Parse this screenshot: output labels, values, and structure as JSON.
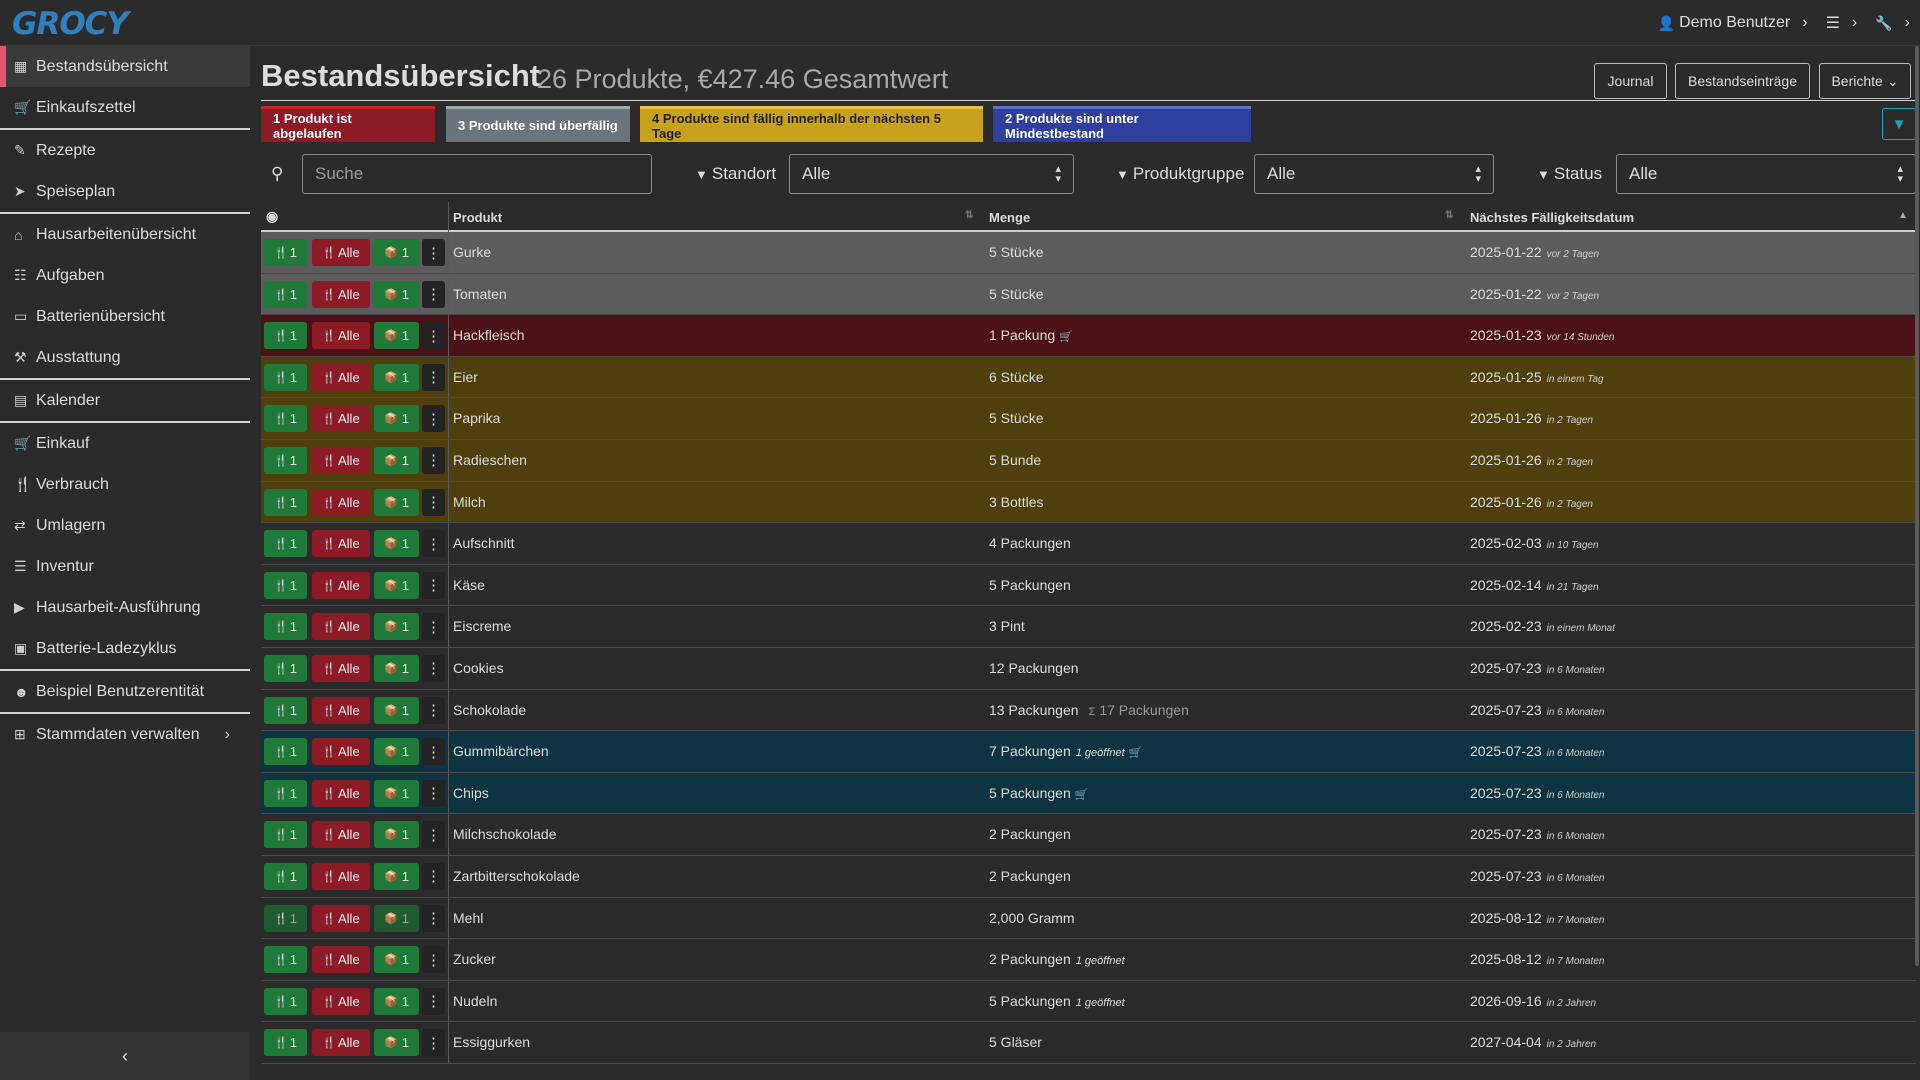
{
  "app": {
    "logo": "GROCY",
    "user": "Demo Benutzer"
  },
  "icons": {
    "user": "👤",
    "settings": "☰",
    "wrench": "🔧",
    "chevron_right": "›",
    "chevron_left": "‹",
    "search": "⚲",
    "filter": "▼",
    "eye": "◉",
    "sort": "⇅",
    "sort_up": "▲",
    "fork_knife": "🍴",
    "box_open": "📦",
    "dots": "⋮",
    "cart": "🛒",
    "sum": "Σ"
  },
  "sidebar": {
    "items": [
      {
        "label": "Bestandsübersicht",
        "icon": "▦"
      },
      {
        "label": "Einkaufszettel",
        "icon": "🛒"
      },
      {
        "label": "Rezepte",
        "icon": "✎"
      },
      {
        "label": "Speiseplan",
        "icon": "➤"
      },
      {
        "label": "Hausarbeitenübersicht",
        "icon": "⌂"
      },
      {
        "label": "Aufgaben",
        "icon": "☷"
      },
      {
        "label": "Batterienübersicht",
        "icon": "▭"
      },
      {
        "label": "Ausstattung",
        "icon": "⚒"
      },
      {
        "label": "Kalender",
        "icon": "▤"
      },
      {
        "label": "Einkauf",
        "icon": "🛒"
      },
      {
        "label": "Verbrauch",
        "icon": "🍴"
      },
      {
        "label": "Umlagern",
        "icon": "⇄"
      },
      {
        "label": "Inventur",
        "icon": "☰"
      },
      {
        "label": "Hausarbeit-Ausführung",
        "icon": "▶"
      },
      {
        "label": "Batterie-Ladezyklus",
        "icon": "▣"
      },
      {
        "label": "Beispiel Benutzerentität",
        "icon": "☻"
      },
      {
        "label": "Stammdaten verwalten",
        "icon": "⊞"
      }
    ],
    "collapse_label": "‹"
  },
  "header": {
    "title": "Bestandsübersicht",
    "subtitle": "26 Produkte, €427.46 Gesamtwert",
    "buttons": {
      "journal": "Journal",
      "entries": "Bestandseinträge",
      "reports": "Berichte"
    },
    "reports_caret": "⌄"
  },
  "badges": {
    "expired": "1 Produkt ist abgelaufen",
    "overdue": "3 Produkte sind überfällig",
    "due_soon": "4 Produkte sind fällig innerhalb der nächsten 5 Tage",
    "below_min": "2 Produkte sind unter Mindestbestand"
  },
  "colors": {
    "expired": "#8d1b25",
    "overdue": "#6c757d",
    "due_soon": "#c7a21a",
    "below_min": "#2e3f9e",
    "row_overdue": "#5c5c5c",
    "row_expired": "#4c1117",
    "row_due_soon": "#4f3f0c",
    "row_below_min": "#0d3440",
    "accent": "#17a2b8"
  },
  "filters": {
    "search_placeholder": "Suche",
    "location_label": "Standort",
    "location_value": "Alle",
    "group_label": "Produktgruppe",
    "group_value": "Alle",
    "status_label": "Status",
    "status_value": "Alle"
  },
  "table": {
    "headers": {
      "product": "Produkt",
      "amount": "Menge",
      "due": "Nächstes Fälligkeitsdatum"
    },
    "btn_one": "1",
    "btn_all": "Alle",
    "rows": [
      {
        "product": "Gurke",
        "amount": "5 Stücke",
        "date": "2025-01-22",
        "rel": "vor 2 Tagen",
        "status": "overdue"
      },
      {
        "product": "Tomaten",
        "amount": "5 Stücke",
        "date": "2025-01-22",
        "rel": "vor 2 Tagen",
        "status": "overdue"
      },
      {
        "product": "Hackfleisch",
        "amount": "1 Packung",
        "cart": true,
        "date": "2025-01-23",
        "rel": "vor 14 Stunden",
        "status": "expired"
      },
      {
        "product": "Eier",
        "amount": "6 Stücke",
        "date": "2025-01-25",
        "rel": "in einem Tag",
        "status": "due_soon"
      },
      {
        "product": "Paprika",
        "amount": "5 Stücke",
        "date": "2025-01-26",
        "rel": "in 2 Tagen",
        "status": "due_soon"
      },
      {
        "product": "Radieschen",
        "amount": "5 Bunde",
        "date": "2025-01-26",
        "rel": "in 2 Tagen",
        "status": "due_soon"
      },
      {
        "product": "Milch",
        "amount": "3 Bottles",
        "date": "2025-01-26",
        "rel": "in 2 Tagen",
        "status": "due_soon"
      },
      {
        "product": "Aufschnitt",
        "amount": "4 Packungen",
        "date": "2025-02-03",
        "rel": "in 10 Tagen",
        "status": "normal"
      },
      {
        "product": "Käse",
        "amount": "5 Packungen",
        "date": "2025-02-14",
        "rel": "in 21 Tagen",
        "status": "normal"
      },
      {
        "product": "Eiscreme",
        "amount": "3 Pint",
        "date": "2025-02-23",
        "rel": "in einem Monat",
        "status": "normal"
      },
      {
        "product": "Cookies",
        "amount": "12 Packungen",
        "date": "2025-07-23",
        "rel": "in 6 Monaten",
        "status": "normal"
      },
      {
        "product": "Schokolade",
        "amount": "13 Packungen",
        "sum": "17 Packungen",
        "date": "2025-07-23",
        "rel": "in 6 Monaten",
        "status": "normal"
      },
      {
        "product": "Gummibärchen",
        "amount": "7 Packungen",
        "opened": "1 geöffnet",
        "cart": true,
        "date": "2025-07-23",
        "rel": "in 6 Monaten",
        "status": "below_min"
      },
      {
        "product": "Chips",
        "amount": "5 Packungen",
        "cart": true,
        "date": "2025-07-23",
        "rel": "in 6 Monaten",
        "status": "below_min"
      },
      {
        "product": "Milchschokolade",
        "amount": "2 Packungen",
        "date": "2025-07-23",
        "rel": "in 6 Monaten",
        "status": "normal"
      },
      {
        "product": "Zartbitterschokolade",
        "amount": "2 Packungen",
        "date": "2025-07-23",
        "rel": "in 6 Monaten",
        "status": "normal"
      },
      {
        "product": "Mehl",
        "amount": "2,000 Gramm",
        "date": "2025-08-12",
        "rel": "in 7 Monaten",
        "status": "normal",
        "disabled": true
      },
      {
        "product": "Zucker",
        "amount": "2 Packungen",
        "opened": "1 geöffnet",
        "date": "2025-08-12",
        "rel": "in 7 Monaten",
        "status": "normal"
      },
      {
        "product": "Nudeln",
        "amount": "5 Packungen",
        "opened": "1 geöffnet",
        "date": "2026-09-16",
        "rel": "in 2 Jahren",
        "status": "normal"
      },
      {
        "product": "Essiggurken",
        "amount": "5 Gläser",
        "date": "2027-04-04",
        "rel": "in 2 Jahren",
        "status": "normal"
      }
    ]
  }
}
